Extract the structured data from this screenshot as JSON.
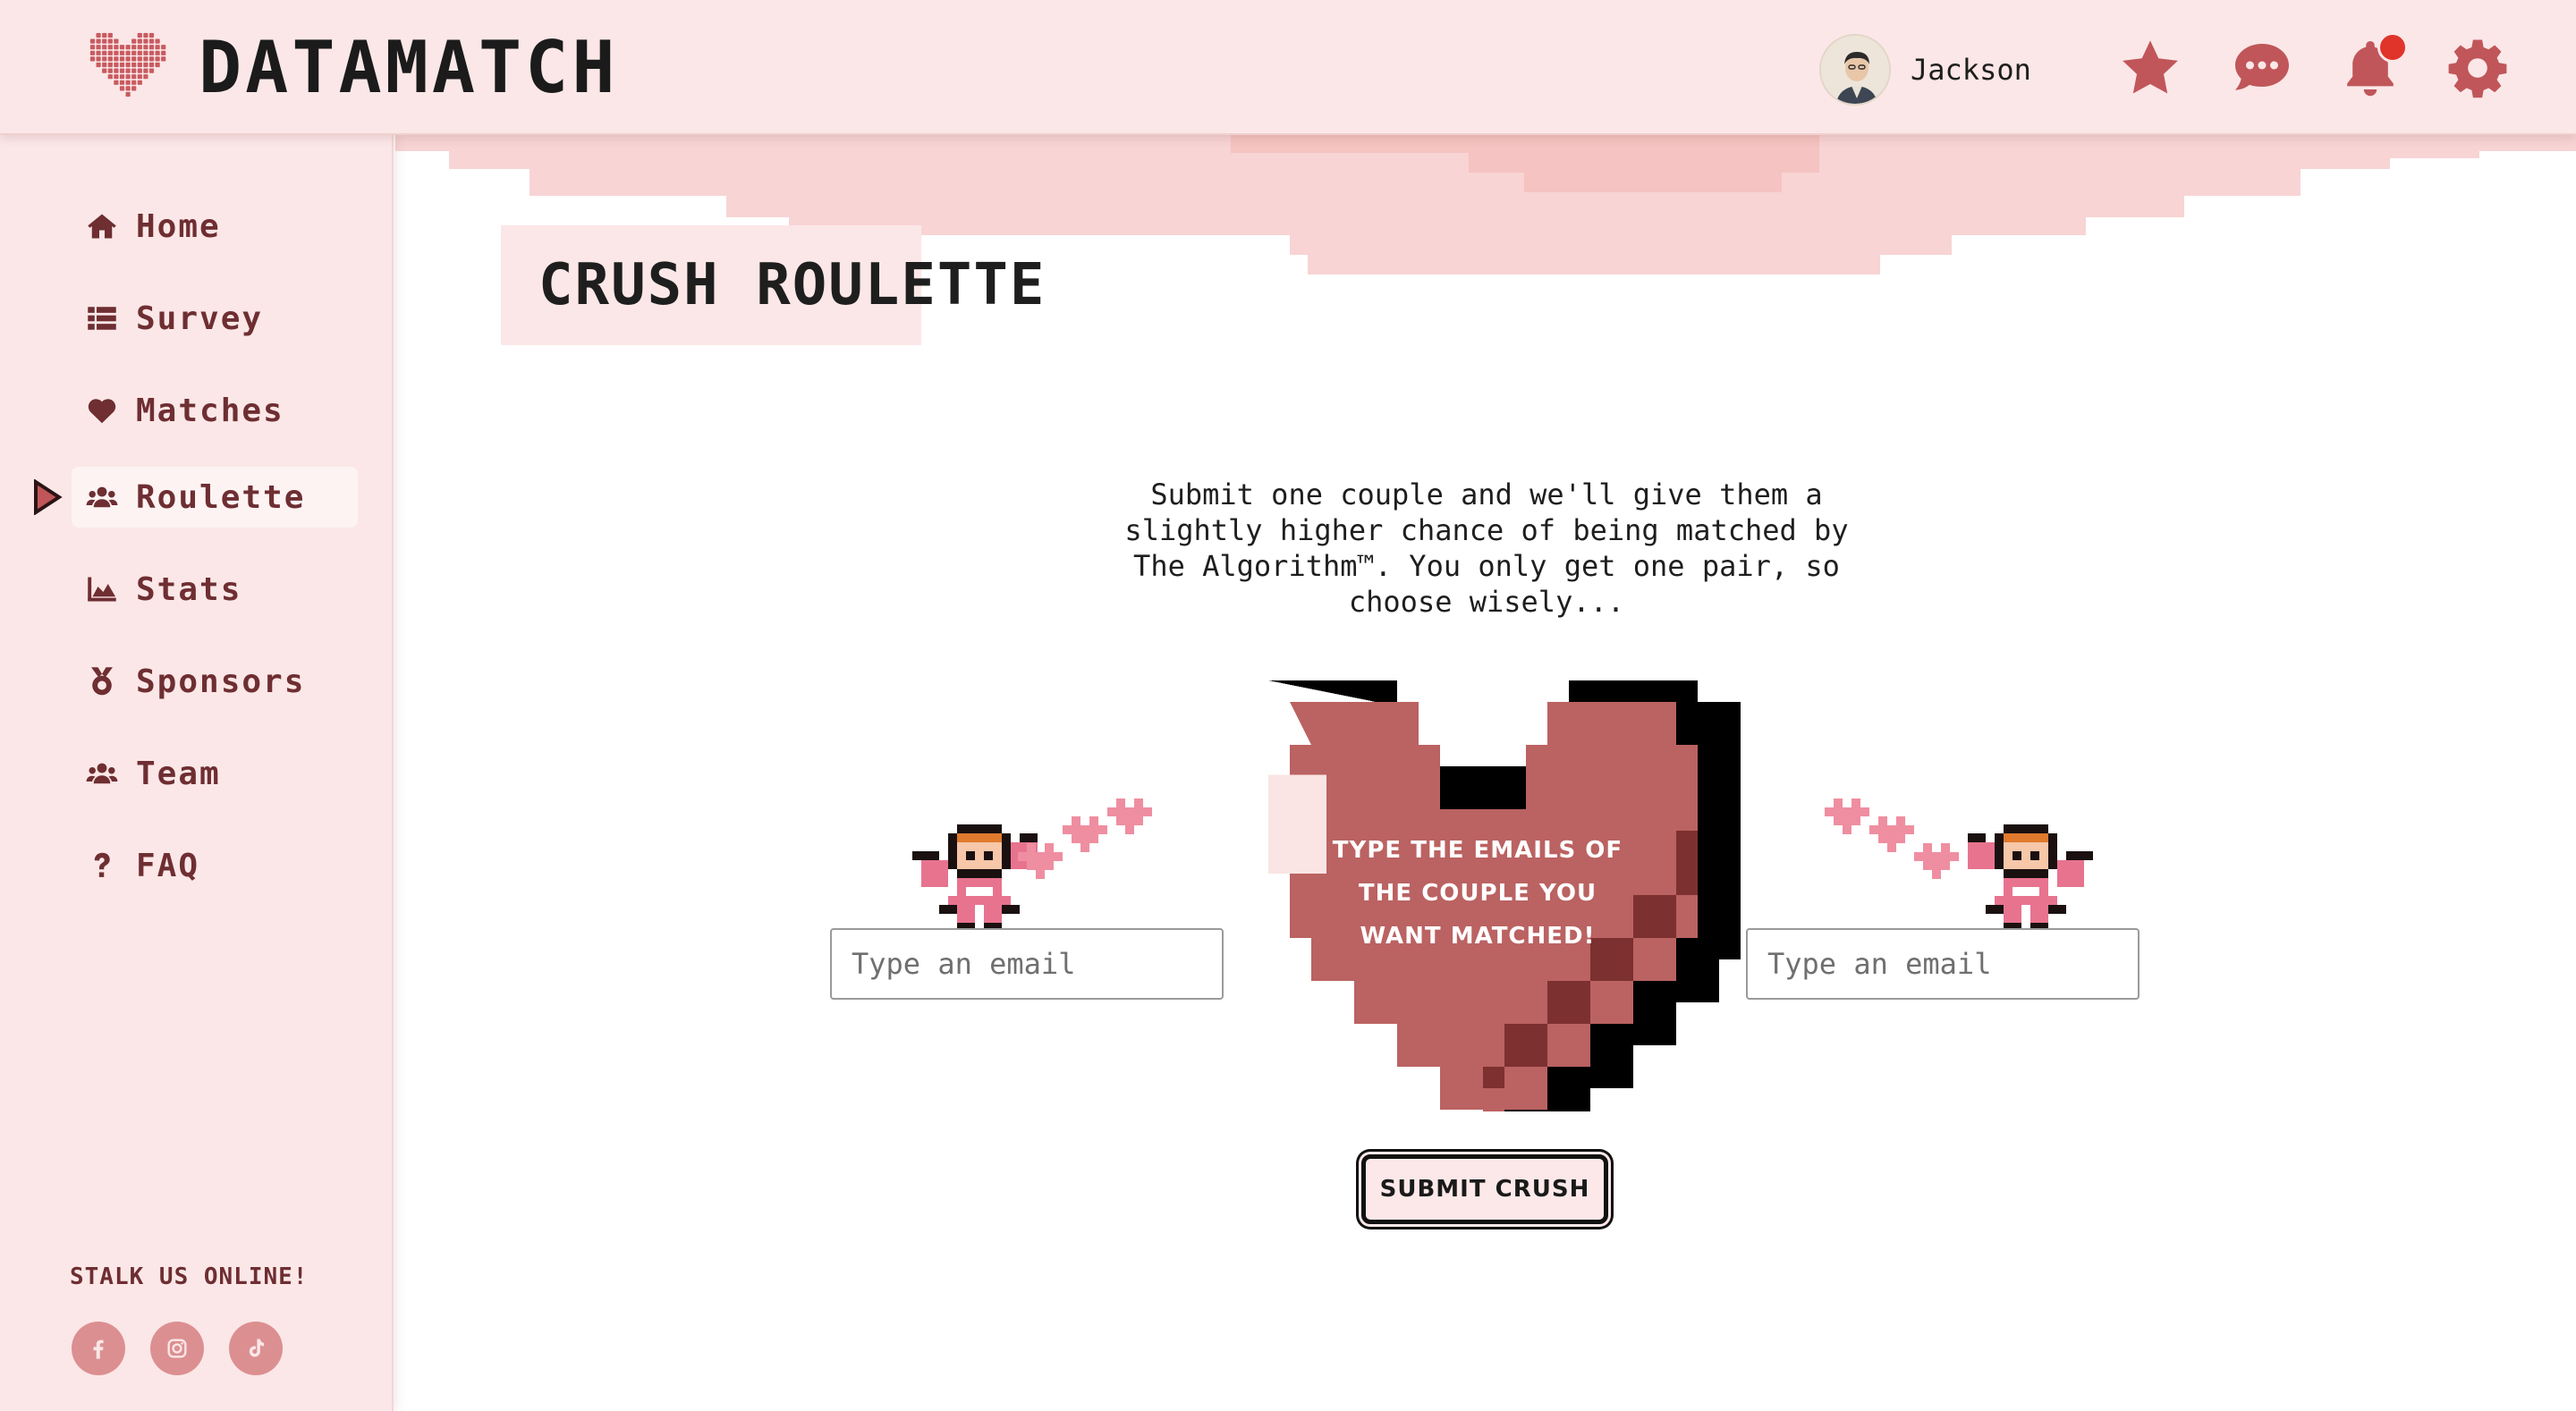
{
  "brand": {
    "name": "DATAMATCH"
  },
  "header": {
    "username": "Jackson",
    "icons": [
      "star-icon",
      "chat-icon",
      "bell-icon",
      "gear-icon"
    ],
    "has_notification": true
  },
  "sidebar": {
    "items": [
      {
        "label": "Home",
        "icon": "home-icon"
      },
      {
        "label": "Survey",
        "icon": "list-icon"
      },
      {
        "label": "Matches",
        "icon": "heart-icon"
      },
      {
        "label": "Roulette",
        "icon": "users-icon",
        "active": true
      },
      {
        "label": "Stats",
        "icon": "chart-area-icon"
      },
      {
        "label": "Sponsors",
        "icon": "medal-icon"
      },
      {
        "label": "Team",
        "icon": "users-icon"
      },
      {
        "label": "FAQ",
        "icon": "question-icon"
      }
    ],
    "footer_title": "STALK US ONLINE!",
    "socials": [
      "facebook-icon",
      "instagram-icon",
      "tiktok-icon"
    ]
  },
  "main": {
    "title": "CRUSH ROULETTE",
    "description": "Submit one couple and we'll give them a slightly higher chance of being matched by The Algorithm™. You only get one pair, so choose wisely...",
    "heart_text": "TYPE THE EMAILS OF THE COUPLE YOU WANT MATCHED!",
    "email_left_placeholder": "Type an email",
    "email_right_placeholder": "Type an email",
    "submit_label": "SUBMIT CRUSH"
  },
  "colors": {
    "accent": "#c0565a",
    "sidebar_bg": "#fbe7e7",
    "heart_fill": "#bb6262",
    "heart_outline": "#000000",
    "notification": "#e0342b"
  }
}
